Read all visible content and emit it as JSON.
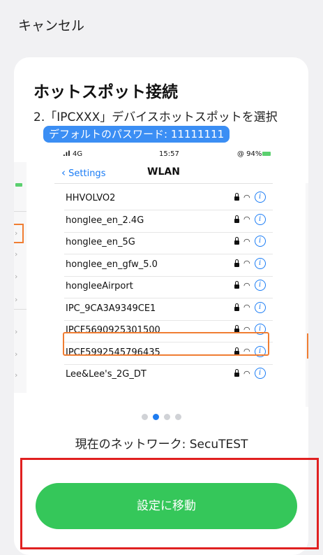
{
  "header": {
    "cancel_label": "キャンセル"
  },
  "card": {
    "title": "ホットスポット接続",
    "step": "2.「IPCXXX」デバイスホットスポットを選択",
    "default_password": "デフォルトのパスワード: 11111111"
  },
  "phone": {
    "status": {
      "signal": "4G",
      "time": "15:57",
      "battery": "@ 94%"
    },
    "nav": {
      "back_label": "Settings",
      "title": "WLAN"
    },
    "networks": [
      "HHVOLVO2",
      "honglee_en_2.4G",
      "honglee_en_5G",
      "honglee_en_gfw_5.0",
      "hongleeAirport",
      "IPC_9CA3A9349CE1",
      "IPCF5690925301500",
      "IPCF5992545796435",
      "Lee&Lee's_2G_DT"
    ],
    "highlighted_network": "IPCF5690925301500"
  },
  "pager": {
    "total": 4,
    "active_index": 1
  },
  "network_status": "現在のネットワーク: SecuTEST",
  "go_settings_label": "設定に移動",
  "colors": {
    "accent": "#35c75a",
    "highlight": "#f07d32",
    "redbox": "#e02020",
    "ios_blue": "#1a7cf5"
  }
}
